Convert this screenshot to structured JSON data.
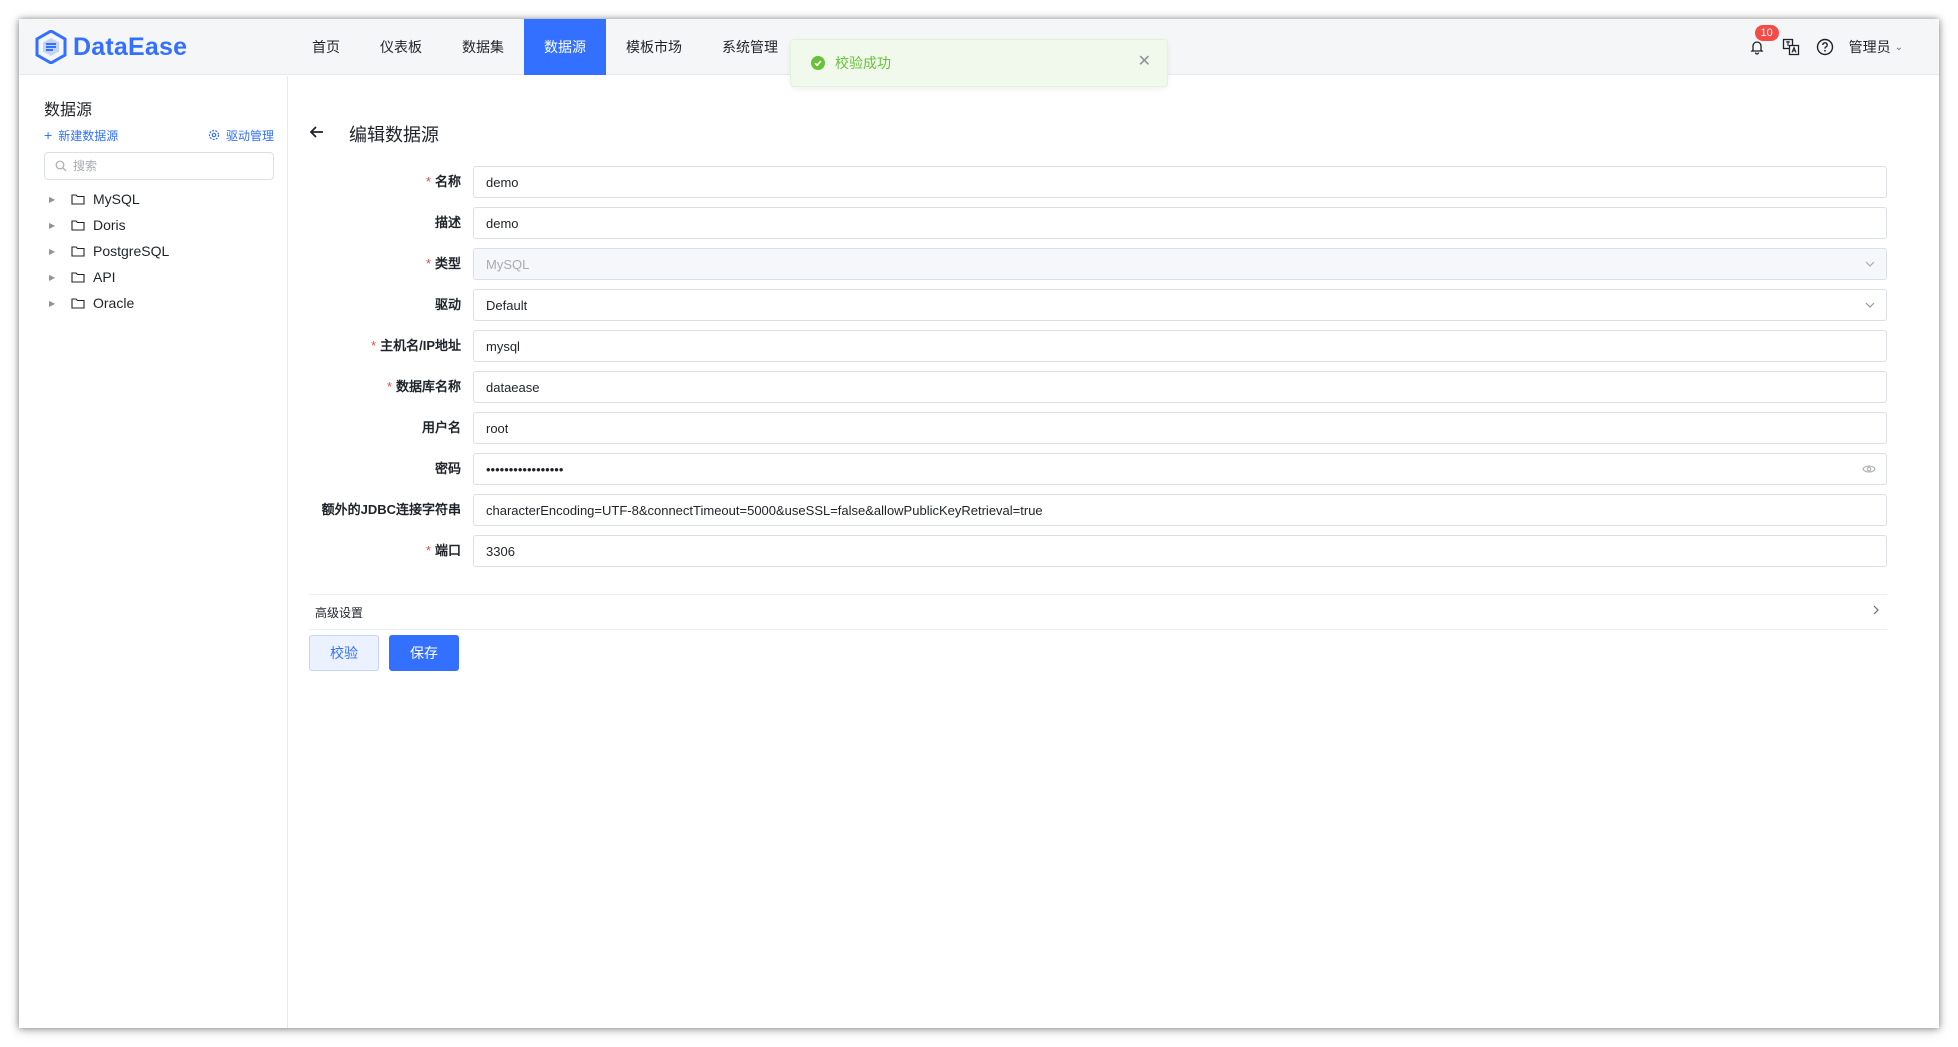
{
  "app": {
    "logo_text": "DataEase"
  },
  "nav": {
    "items": [
      {
        "label": "首页"
      },
      {
        "label": "仪表板"
      },
      {
        "label": "数据集"
      },
      {
        "label": "数据源"
      },
      {
        "label": "模板市场"
      },
      {
        "label": "系统管理"
      }
    ],
    "active_index": 3
  },
  "header": {
    "notification_count": "10",
    "user_name": "管理员",
    "icons": [
      "bell-icon",
      "translate-icon",
      "help-icon"
    ]
  },
  "toast": {
    "message": "校验成功",
    "type": "success"
  },
  "sidebar": {
    "title": "数据源",
    "new_label": "新建数据源",
    "driver_label": "驱动管理",
    "search_placeholder": "搜索",
    "tree": [
      {
        "label": "MySQL"
      },
      {
        "label": "Doris"
      },
      {
        "label": "PostgreSQL"
      },
      {
        "label": "API"
      },
      {
        "label": "Oracle"
      }
    ]
  },
  "main": {
    "title": "编辑数据源",
    "fields": {
      "name": {
        "label": "名称",
        "value": "demo",
        "required": true
      },
      "desc": {
        "label": "描述",
        "value": "demo",
        "required": false
      },
      "type": {
        "label": "类型",
        "value": "MySQL",
        "required": true,
        "disabled": true
      },
      "driver": {
        "label": "驱动",
        "value": "Default",
        "required": false
      },
      "host": {
        "label": "主机名/IP地址",
        "value": "mysql",
        "required": true
      },
      "db": {
        "label": "数据库名称",
        "value": "dataease",
        "required": true
      },
      "user": {
        "label": "用户名",
        "value": "root",
        "required": false
      },
      "password": {
        "label": "密码",
        "value": "•••••••••••••••••",
        "required": false
      },
      "jdbc": {
        "label": "额外的JDBC连接字符串",
        "value": "characterEncoding=UTF-8&connectTimeout=5000&useSSL=false&allowPublicKeyRetrieval=true",
        "required": false
      },
      "port": {
        "label": "端口",
        "value": "3306",
        "required": true
      }
    },
    "advanced_label": "高级设置",
    "validate_button": "校验",
    "save_button": "保存"
  },
  "colors": {
    "accent": "#3370ff",
    "success": "#67c23a",
    "required": "#f54a45",
    "badge": "#f54a45"
  }
}
